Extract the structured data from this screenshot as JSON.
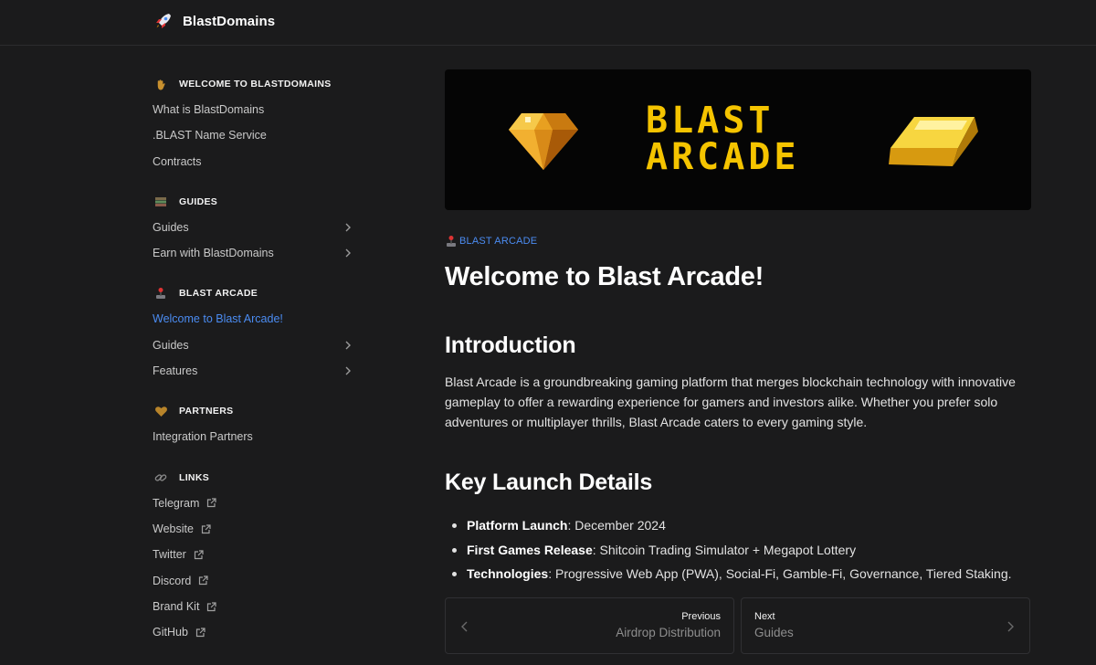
{
  "header": {
    "brand_name": "BlastDomains",
    "logo_icon": "rocket-icon"
  },
  "sidebar": {
    "sections": [
      {
        "title": "WELCOME TO BLASTDOMAINS",
        "icon": "waving-hand-icon",
        "items": [
          {
            "label": "What is BlastDomains"
          },
          {
            "label": ".BLAST Name Service"
          },
          {
            "label": "Contracts"
          }
        ]
      },
      {
        "title": "GUIDES",
        "icon": "books-icon",
        "items": [
          {
            "label": "Guides",
            "expandable": true
          },
          {
            "label": "Earn with BlastDomains",
            "expandable": true
          }
        ]
      },
      {
        "title": "BLAST ARCADE",
        "icon": "joystick-icon",
        "items": [
          {
            "label": "Welcome to Blast Arcade!",
            "active": true
          },
          {
            "label": "Guides",
            "expandable": true
          },
          {
            "label": "Features",
            "expandable": true
          }
        ]
      },
      {
        "title": "PARTNERS",
        "icon": "heart-hands-icon",
        "items": [
          {
            "label": "Integration Partners"
          }
        ]
      },
      {
        "title": "LINKS",
        "icon": "link-icon",
        "items": [
          {
            "label": "Telegram",
            "external": true
          },
          {
            "label": "Website",
            "external": true
          },
          {
            "label": "Twitter",
            "external": true
          },
          {
            "label": "Discord",
            "external": true
          },
          {
            "label": "Brand Kit",
            "external": true
          },
          {
            "label": "GitHub",
            "external": true
          }
        ]
      }
    ]
  },
  "main": {
    "banner": {
      "line1": "BLAST",
      "line2": "ARCADE",
      "left_icon": "pixel-gem-icon",
      "right_icon": "pixel-gold-bar-icon"
    },
    "breadcrumb": "BLAST ARCADE",
    "breadcrumb_icon": "joystick-icon",
    "title": "Welcome to Blast Arcade!",
    "intro_heading": "Introduction",
    "intro_text": "Blast Arcade is a groundbreaking gaming platform that merges blockchain technology with innovative gameplay to offer a rewarding experience for gamers and investors alike. Whether you prefer solo adventures or multiplayer thrills, Blast Arcade caters to every gaming style.",
    "launch_heading": "Key Launch Details",
    "launch_items": [
      {
        "term": "Platform Launch",
        "value": ": December 2024"
      },
      {
        "term": "First Games Release",
        "value": ": Shitcoin Trading Simulator + Megapot Lottery"
      },
      {
        "term": "Technologies",
        "value": ": Progressive Web App (PWA), Social-Fi, Gamble-Fi, Governance, Tiered Staking."
      }
    ]
  },
  "pager": {
    "prev_label": "Previous",
    "prev_title": "Airdrop Distribution",
    "next_label": "Next",
    "next_title": "Guides"
  },
  "colors": {
    "background": "#1b1b1c",
    "accent": "#4b8cf2",
    "banner_text": "#f5c400"
  }
}
